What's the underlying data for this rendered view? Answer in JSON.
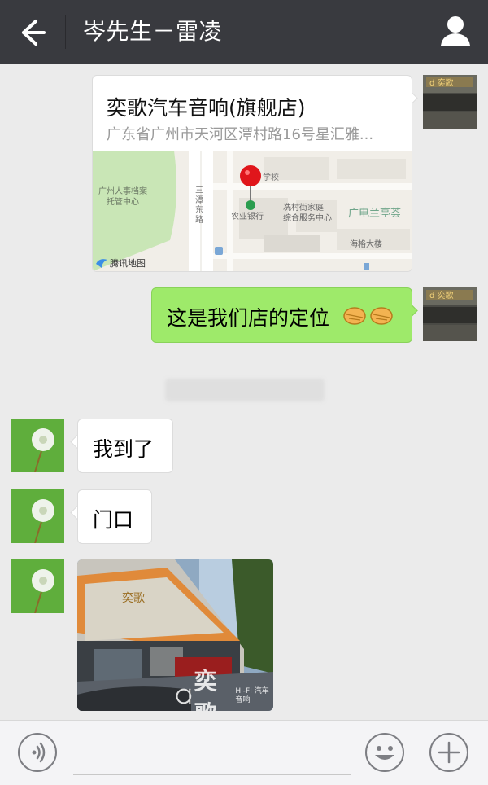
{
  "header": {
    "title": "岑先生－雷凌",
    "back_icon": "back-arrow-icon",
    "user_icon": "user-profile-icon"
  },
  "messages": [
    {
      "type": "location",
      "sender": "self",
      "place_name": "奕歌汽车音响(旗舰店)",
      "address": "广东省广州市天河区潭村路16号星汇雅...",
      "map_labels": {
        "area_1": "广州人事档案",
        "area_2": "托管中心",
        "road": "三\n潭\n东\n路",
        "school": "学校",
        "bank": "农业银行",
        "service_1": "冼村街家庭",
        "service_2": "综合服务中心",
        "district": "广电兰亭荟",
        "building": "海格大楼",
        "provider": "腾讯地图"
      }
    },
    {
      "type": "text",
      "sender": "self",
      "text": "这是我们店的定位",
      "emoji": "handshake-emoji"
    },
    {
      "type": "text",
      "sender": "peer",
      "text": "我到了"
    },
    {
      "type": "text",
      "sender": "peer",
      "text": "门口"
    },
    {
      "type": "image",
      "sender": "peer",
      "watermark_brand": "奕歌",
      "watermark_sub": "HI-FI 汽车音响"
    }
  ],
  "footer": {
    "voice_icon": "voice-input-icon",
    "emoji_icon": "emoji-smile-icon",
    "plus_icon": "plus-more-icon"
  },
  "colors": {
    "header_bg": "#393a3f",
    "chat_bg": "#ebebeb",
    "bubble_green": "#9eea6a",
    "bubble_white": "#ffffff"
  }
}
